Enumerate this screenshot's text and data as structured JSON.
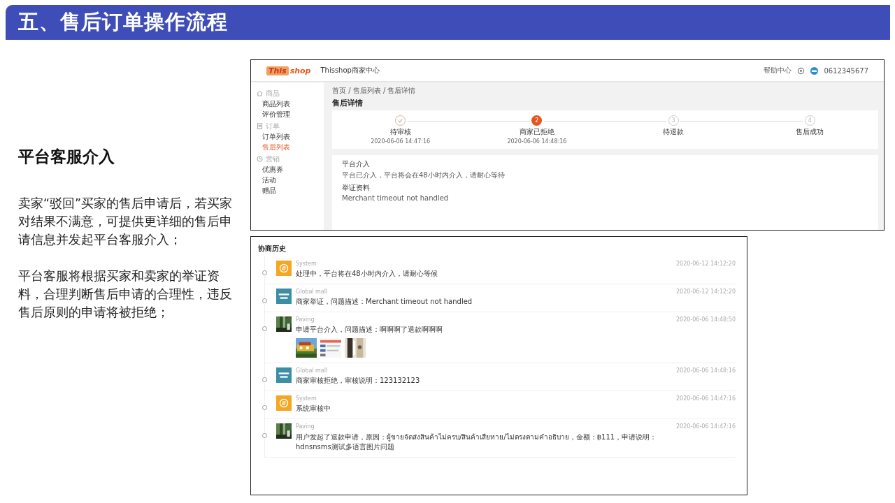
{
  "header": {
    "title": "五、售后订单操作流程"
  },
  "section": {
    "heading": "平台客服介入",
    "paragraphs": [
      "卖家“驳回”买家的售后申请后，若买家对结果不满意，可提供更详细的售后申请信息并发起平台客服介入；",
      "平台客服将根据买家和卖家的举证资料，合理判断售后申请的合理性，违反售后原则的申请将被拒绝；"
    ]
  },
  "merchant_screen": {
    "logo": {
      "tag": "This",
      "word": "shop"
    },
    "app_title": "Thisshop商家中心",
    "help": "帮助中心",
    "account": "0612345677",
    "sidebar": [
      {
        "group": "商品",
        "items": [
          {
            "label": "商品列表",
            "selected": false
          },
          {
            "label": "评价管理",
            "selected": false
          }
        ]
      },
      {
        "group": "订单",
        "items": [
          {
            "label": "订单列表",
            "selected": false
          },
          {
            "label": "售后列表",
            "selected": true
          }
        ]
      },
      {
        "group": "营销",
        "items": [
          {
            "label": "优惠券",
            "selected": false
          },
          {
            "label": "活动",
            "selected": false
          },
          {
            "label": "赠品",
            "selected": false
          }
        ]
      }
    ],
    "breadcrumb": "首页 / 售后列表 / 售后详情",
    "page_title": "售后详情",
    "steps": [
      {
        "label": "待审核",
        "time": "2020-06-06 14:47:16",
        "done": true,
        "current": false
      },
      {
        "label": "商家已拒绝",
        "time": "2020-06-06 14:48:16",
        "done": false,
        "current": true,
        "number": "2"
      },
      {
        "label": "待退款",
        "done": false,
        "current": false,
        "number": "3"
      },
      {
        "label": "售后成功",
        "done": false,
        "current": false,
        "number": "4"
      }
    ],
    "panel": {
      "title": "平台介入",
      "text": "平台已介入，平台将会在48小时内介入，请耐心等待",
      "evidence_title": "举证资料",
      "evidence_text": "Merchant timeout not handled"
    }
  },
  "history": {
    "title": "协商历史",
    "entries": [
      {
        "kind": "system",
        "author": "System",
        "time": "2020-06-12 14:12:20",
        "message": "处理中，平台将在48小时内介入，请耐心等候"
      },
      {
        "kind": "store",
        "author": "Global mall",
        "time": "2020-06-12 14:12:20",
        "message": "商家举证，问题描述：Merchant timeout not handled"
      },
      {
        "author": "Paving",
        "time": "2020-06-06 14:48:50",
        "message": "申请平台介入，问题描述：啊啊啊了退款啊啊啊"
      },
      {
        "kind": "store",
        "author": "Global mall",
        "time": "2020-06-06 14:48:16",
        "message": "商家审核拒绝，审核说明：123132123"
      },
      {
        "kind": "system",
        "author": "System",
        "time": "2020-06-06 14:47:16",
        "message": "系统审核中"
      },
      {
        "author": "Paving",
        "time": "2020-06-06 14:47:16",
        "message": "用户发起了退款申请，原因：ผู้ขายจัดส่งสินค้าไม่ครบ/สินค้าเสียหาย/ไม่ตรงตามคำอธิบาย，金额：฿111，申请说明：hdnsnsms测试多语言图片问题"
      }
    ]
  }
}
